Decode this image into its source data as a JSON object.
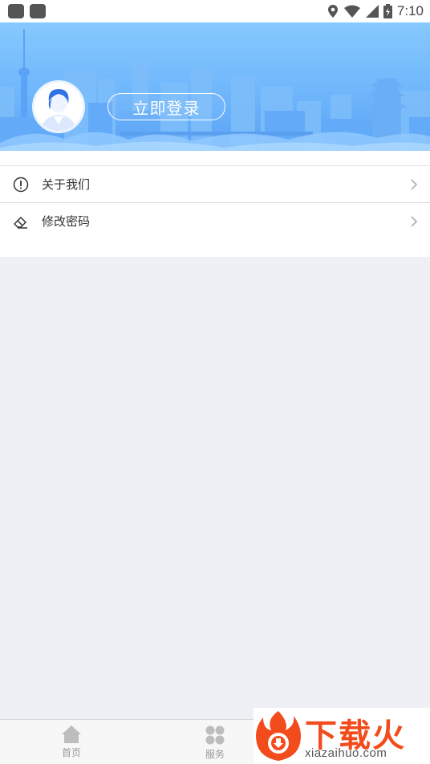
{
  "status_bar": {
    "time": "7:10"
  },
  "header": {
    "login_label": "立即登录"
  },
  "menu": {
    "items": [
      {
        "label": "关于我们",
        "icon": "info-icon"
      },
      {
        "label": "修改密码",
        "icon": "eraser-icon"
      }
    ]
  },
  "tabbar": {
    "tabs": [
      {
        "label": "首页",
        "icon": "home-icon"
      },
      {
        "label": "服务",
        "icon": "grid-icon"
      }
    ]
  },
  "watermark": {
    "brand": "下载火",
    "url": "xiazaihuo.com"
  },
  "colors": {
    "header_top": "#86c9ff",
    "header_bottom": "#5aa3f6",
    "background": "#eff0f5",
    "watermark": "#f24c1c"
  }
}
